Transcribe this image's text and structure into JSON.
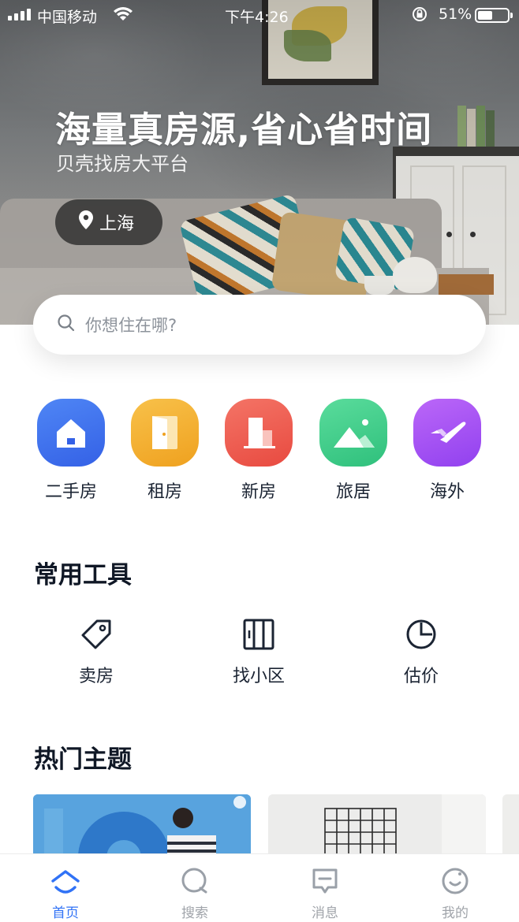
{
  "status_bar": {
    "carrier": "中国移动",
    "time": "下午4:26",
    "battery": "51%",
    "battery_level": 0.51
  },
  "hero": {
    "headline": "海量真房源,省心省时间",
    "subline": "贝壳找房大平台",
    "city": "上海"
  },
  "search": {
    "placeholder": "你想住在哪?"
  },
  "categories": [
    {
      "label": "二手房",
      "icon": "house-icon",
      "color": "#3d6fed"
    },
    {
      "label": "租房",
      "icon": "door-icon",
      "color": "#f3b12f"
    },
    {
      "label": "新房",
      "icon": "building-icon",
      "color": "#ee5a4e"
    },
    {
      "label": "旅居",
      "icon": "mountain-icon",
      "color": "#3fce8a"
    },
    {
      "label": "海外",
      "icon": "plane-icon",
      "color": "#a64df5"
    }
  ],
  "tools": {
    "title": "常用工具",
    "items": [
      {
        "label": "卖房",
        "icon": "tag-icon"
      },
      {
        "label": "找小区",
        "icon": "map-icon"
      },
      {
        "label": "估价",
        "icon": "pie-chart-icon"
      }
    ]
  },
  "topics": {
    "title": "热门主题"
  },
  "tabbar": {
    "items": [
      {
        "label": "首页",
        "icon": "home-icon",
        "active": true
      },
      {
        "label": "搜索",
        "icon": "search-icon",
        "active": false
      },
      {
        "label": "消息",
        "icon": "message-icon",
        "active": false
      },
      {
        "label": "我的",
        "icon": "profile-icon",
        "active": false
      }
    ],
    "accent": "#3072f6"
  }
}
